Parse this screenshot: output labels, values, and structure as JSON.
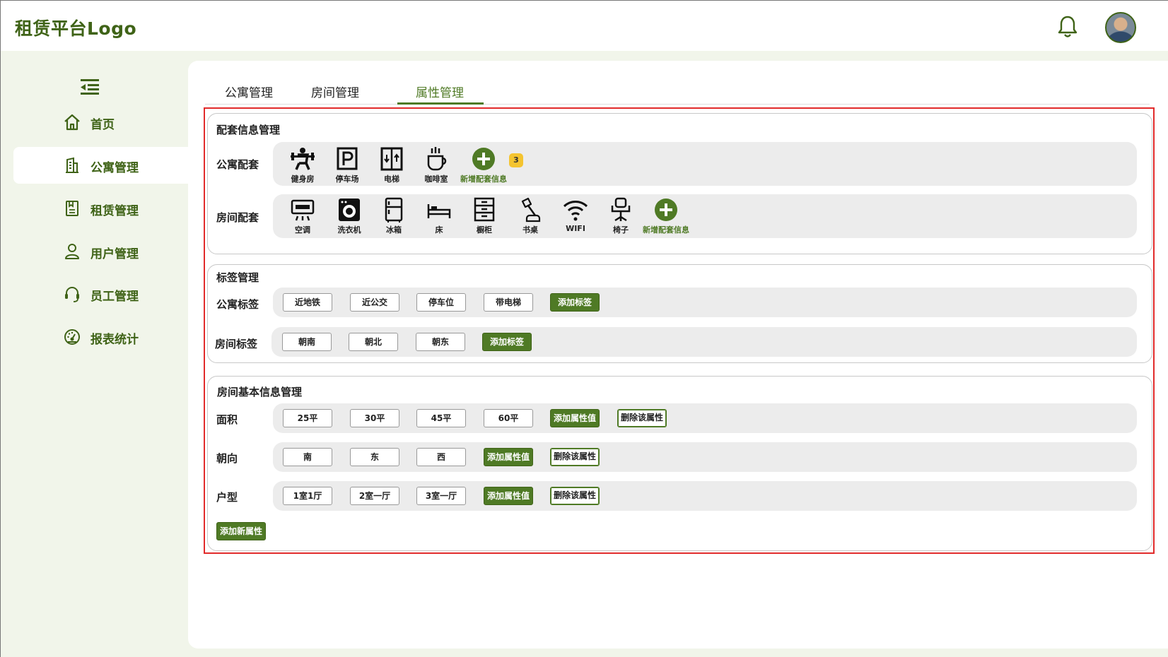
{
  "app": {
    "logo": "租赁平台Logo"
  },
  "header": {
    "bell_icon": "bell-icon",
    "avatar": "user-avatar"
  },
  "sidebar": {
    "collapse_icon": "menu-collapse-icon",
    "items": [
      {
        "label": "首页",
        "icon": "home-icon",
        "active": false
      },
      {
        "label": "公寓管理",
        "icon": "building-icon",
        "active": true
      },
      {
        "label": "租赁管理",
        "icon": "contract-icon",
        "active": false
      },
      {
        "label": "用户管理",
        "icon": "user-icon",
        "active": false
      },
      {
        "label": "员工管理",
        "icon": "headset-icon",
        "active": false
      },
      {
        "label": "报表统计",
        "icon": "dashboard-icon",
        "active": false
      }
    ]
  },
  "tabs": [
    {
      "label": "公寓管理",
      "active": false
    },
    {
      "label": "房间管理",
      "active": false
    },
    {
      "label": "属性管理",
      "active": true
    }
  ],
  "facilities": {
    "title": "配套信息管理",
    "apartment": {
      "label": "公寓配套",
      "items": [
        {
          "label": "健身房",
          "icon": "gym-icon"
        },
        {
          "label": "停车场",
          "icon": "parking-icon"
        },
        {
          "label": "电梯",
          "icon": "elevator-icon"
        },
        {
          "label": "咖啡室",
          "icon": "coffee-icon"
        }
      ],
      "add_label": "新增配套信息",
      "badge": "3"
    },
    "room": {
      "label": "房间配套",
      "items": [
        {
          "label": "空调",
          "icon": "air-conditioner-icon"
        },
        {
          "label": "洗衣机",
          "icon": "washing-machine-icon"
        },
        {
          "label": "冰箱",
          "icon": "fridge-icon"
        },
        {
          "label": "床",
          "icon": "bed-icon"
        },
        {
          "label": "橱柜",
          "icon": "cabinet-icon"
        },
        {
          "label": "书桌",
          "icon": "desk-lamp-icon"
        },
        {
          "label": "WIFI",
          "icon": "wifi-icon"
        },
        {
          "label": "椅子",
          "icon": "chair-icon"
        }
      ],
      "add_label": "新增配套信息"
    }
  },
  "tags": {
    "title": "标签管理",
    "apartment": {
      "label": "公寓标签",
      "items": [
        "近地铁",
        "近公交",
        "停车位",
        "带电梯"
      ],
      "add_label": "添加标签"
    },
    "room": {
      "label": "房间标签",
      "items": [
        "朝南",
        "朝北",
        "朝东"
      ],
      "add_label": "添加标签"
    }
  },
  "room_info": {
    "title": "房间基本信息管理",
    "attributes": [
      {
        "label": "面积",
        "values": [
          "25平",
          "30平",
          "45平",
          "60平"
        ]
      },
      {
        "label": "朝向",
        "values": [
          "南",
          "东",
          "西"
        ]
      },
      {
        "label": "户型",
        "values": [
          "1室1厅",
          "2室一厅",
          "3室一厅"
        ]
      }
    ],
    "add_value_label": "添加属性值",
    "delete_label": "删除该属性",
    "add_attr_label": "添加新属性"
  },
  "colors": {
    "brand": "#4f7a25",
    "brand_dark": "#3f6317",
    "highlight": "#e12b2b",
    "badge": "#f4c430"
  }
}
